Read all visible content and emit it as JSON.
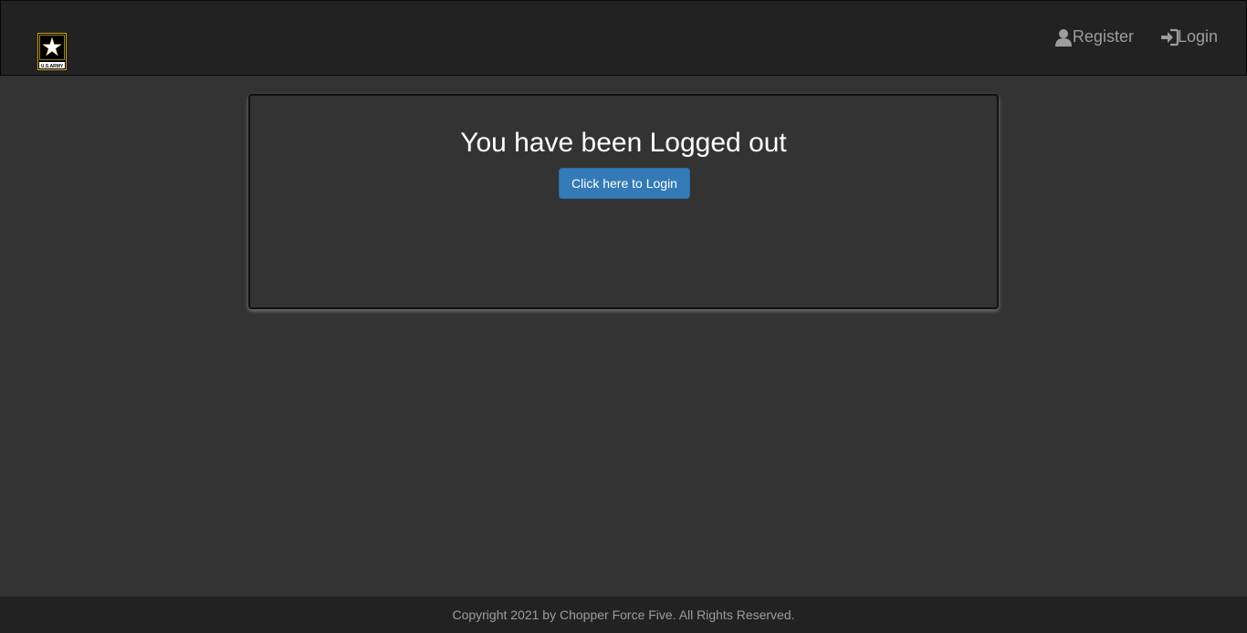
{
  "navbar": {
    "logo_icon": "us-army-star-logo",
    "logo_text": "U.S.ARMY",
    "links": [
      {
        "label": "Register",
        "icon": "user-icon"
      },
      {
        "label": "Login",
        "icon": "login-icon"
      }
    ]
  },
  "main": {
    "title": "You have been Logged out",
    "button_label": "Click here to Login"
  },
  "footer": {
    "copyright": "Copyright 2021 by Chopper Force Five. All Rights Reserved."
  },
  "colors": {
    "background": "#333333",
    "navbar": "#222222",
    "primary_button": "#337ab7",
    "logo_gold": "#c9a227"
  }
}
